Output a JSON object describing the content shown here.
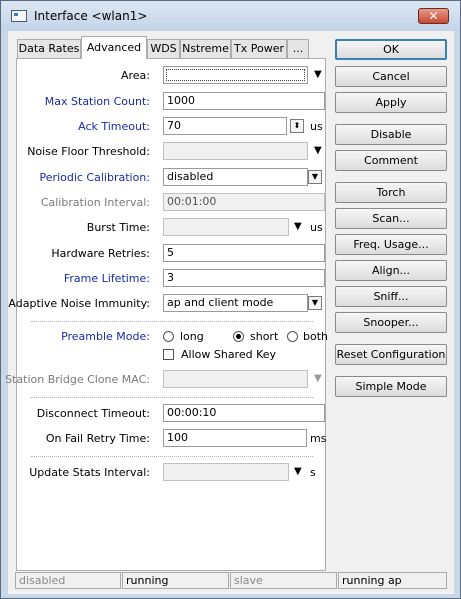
{
  "window": {
    "title": "Interface <wlan1>",
    "close_symbol": "✕"
  },
  "tabs": [
    {
      "label": "Data Rates",
      "active": false
    },
    {
      "label": "Advanced",
      "active": true
    },
    {
      "label": "WDS",
      "active": false
    },
    {
      "label": "Nstreme",
      "active": false
    },
    {
      "label": "Tx Power",
      "active": false
    },
    {
      "label": "...",
      "active": false
    }
  ],
  "form": {
    "area": {
      "label": "Area:",
      "value": ""
    },
    "max_station_count": {
      "label": "Max Station Count:",
      "value": "1000"
    },
    "ack_timeout": {
      "label": "Ack Timeout:",
      "value": "70",
      "unit": "us"
    },
    "noise_floor_threshold": {
      "label": "Noise Floor Threshold:",
      "value": ""
    },
    "periodic_calibration": {
      "label": "Periodic Calibration:",
      "value": "disabled"
    },
    "calibration_interval": {
      "label": "Calibration Interval:",
      "value": "00:01:00"
    },
    "burst_time": {
      "label": "Burst Time:",
      "value": "",
      "unit": "us"
    },
    "hardware_retries": {
      "label": "Hardware Retries:",
      "value": "5"
    },
    "frame_lifetime": {
      "label": "Frame Lifetime:",
      "value": "3"
    },
    "adaptive_noise_immunity": {
      "label": "Adaptive Noise Immunity:",
      "value": "ap and client mode"
    },
    "preamble_mode": {
      "label": "Preamble Mode:",
      "options": [
        "long",
        "short",
        "both"
      ],
      "selected": "short"
    },
    "allow_shared_key": {
      "label": "Allow Shared Key",
      "checked": false
    },
    "station_bridge_clone_mac": {
      "label": "Station Bridge Clone MAC:",
      "value": ""
    },
    "disconnect_timeout": {
      "label": "Disconnect Timeout:",
      "value": "00:00:10"
    },
    "on_fail_retry_time": {
      "label": "On Fail Retry Time:",
      "value": "100",
      "unit": "ms"
    },
    "update_stats_interval": {
      "label": "Update Stats Interval:",
      "value": "",
      "unit": "s"
    }
  },
  "buttons": {
    "ok": "OK",
    "cancel": "Cancel",
    "apply": "Apply",
    "disable": "Disable",
    "comment": "Comment",
    "torch": "Torch",
    "scan": "Scan...",
    "freq_usage": "Freq. Usage...",
    "align": "Align...",
    "sniff": "Sniff...",
    "snooper": "Snooper...",
    "reset_configuration": "Reset Configuration",
    "simple_mode": "Simple Mode"
  },
  "status_bar": [
    "disabled",
    "running",
    "slave",
    "running ap"
  ],
  "icons": {
    "dropdown": "▼",
    "spin": "⬍"
  }
}
